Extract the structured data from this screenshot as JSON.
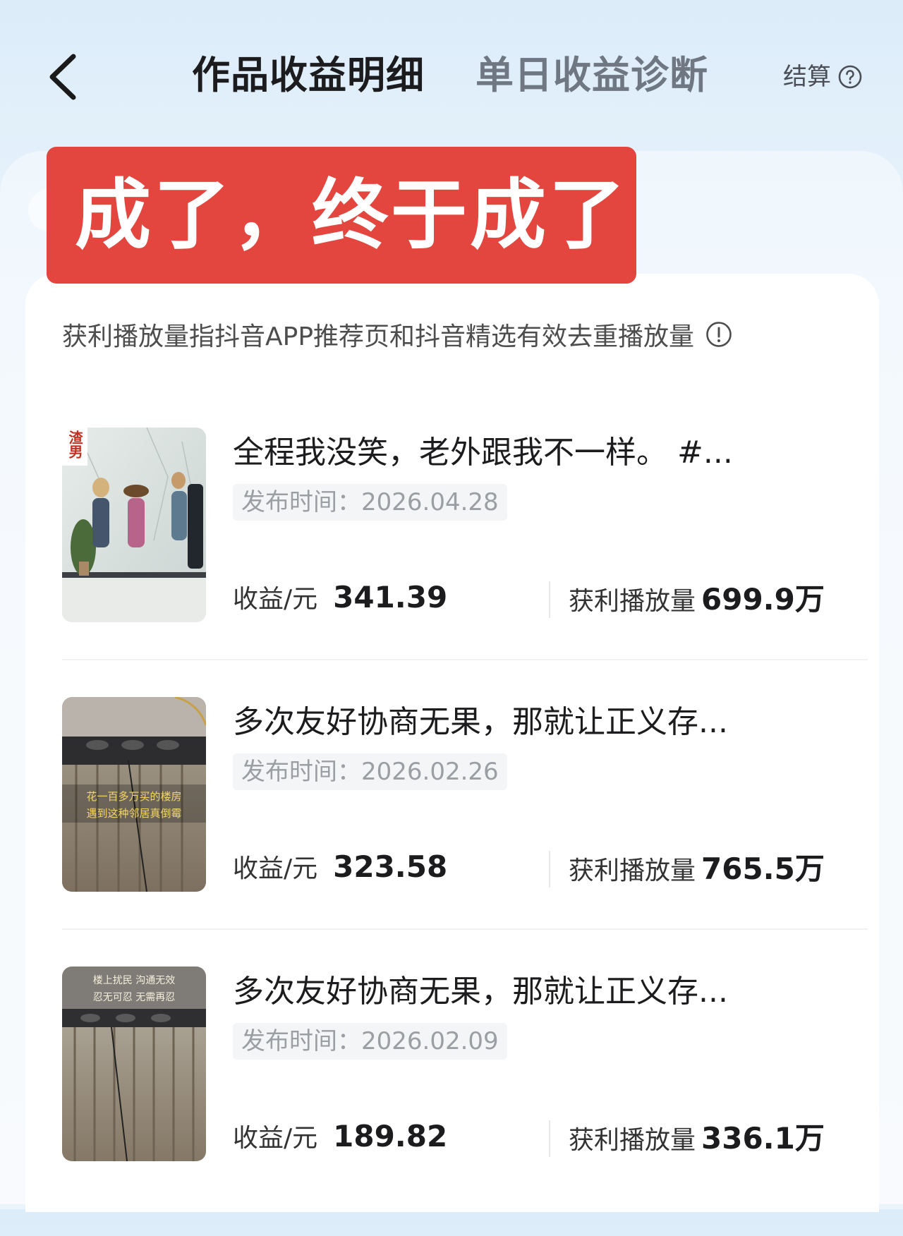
{
  "header": {
    "active_tab": "作品收益明细",
    "inactive_tab": "单日收益诊断",
    "settle_label": "结算"
  },
  "banner": {
    "text": "成了，终于成了"
  },
  "note": {
    "text": "获利播放量指抖音APP推荐页和抖音精选有效去重播放量"
  },
  "items": [
    {
      "title": "全程我没笑，老外跟我不一样。 #...",
      "date": "发布时间：2026.04.28",
      "income_label": "收益/元",
      "income_value": "341.39",
      "plays_label": "获利播放量",
      "plays_value": "699.9万",
      "thumb_badge": "渣男",
      "thumb_caption": ""
    },
    {
      "title": "多次友好协商无果，那就让正义存...",
      "date": "发布时间：2026.02.26",
      "income_label": "收益/元",
      "income_value": "323.58",
      "plays_label": "获利播放量",
      "plays_value": "765.5万",
      "thumb_badge": "",
      "thumb_caption": "花一百多万买的楼房 遇到这种邻居真倒霉"
    },
    {
      "title": "多次友好协商无果，那就让正义存...",
      "date": "发布时间：2026.02.09",
      "income_label": "收益/元",
      "income_value": "189.82",
      "plays_label": "获利播放量",
      "plays_value": "336.1万",
      "thumb_badge": "",
      "thumb_caption": "楼上扰民 沟通无效 忍无可忍 无需再忍"
    }
  ],
  "icons": {
    "back": "chevron-left-icon",
    "help": "question-circle-icon",
    "info": "exclamation-circle-icon"
  },
  "colors": {
    "banner": "#e2463f",
    "background": "#dcecf9"
  }
}
